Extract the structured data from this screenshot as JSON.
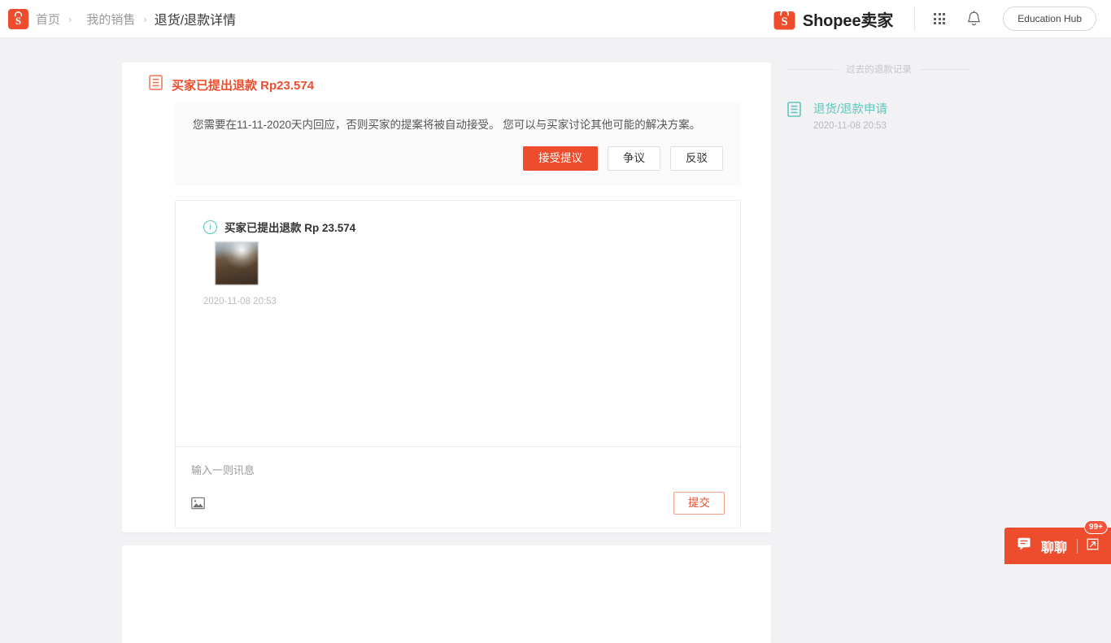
{
  "header": {
    "breadcrumb": [
      {
        "label": "首页",
        "current": false
      },
      {
        "label": "我的销售",
        "current": false
      },
      {
        "label": "退货/退款详情",
        "current": true
      }
    ],
    "separator": "›",
    "brand_name": "Shopee卖家",
    "apps_icon": "grid-apps-icon",
    "bell_icon": "bell-icon",
    "education_hub_label": "Education Hub",
    "brand_color": "#ee4d2d"
  },
  "alert": {
    "doc_icon": "document-icon",
    "title": "买家已提出退款 Rp23.574",
    "message": "您需要在11-11-2020天内回应，否则买家的提案将被自动接受。 您可以与买家讨论其他可能的解决方案。",
    "buttons": [
      {
        "label": "接受提议",
        "style": "primary",
        "name": "accept-proposal-button"
      },
      {
        "label": "争议",
        "style": "ghost",
        "name": "dispute-button"
      },
      {
        "label": "反驳",
        "style": "ghost",
        "name": "rebut-button"
      }
    ]
  },
  "chat": {
    "messages": [
      {
        "icon": "info-circle-icon",
        "title": "买家已提出退款 Rp 23.574",
        "attachment": "refund-photo-thumbnail",
        "time": "2020-11-08 20:53"
      }
    ],
    "input_placeholder": "输入一则讯息",
    "input_value": "",
    "image_upload_icon": "image-upload-icon",
    "submit_label": "提交"
  },
  "rail": {
    "section_label": "过去的退款记录",
    "items": [
      {
        "icon": "document-icon",
        "title": "退货/退款申请",
        "time": "2020-11-08 20:53",
        "color": "#5bc8bb"
      }
    ]
  },
  "chat_widget": {
    "icon": "chat-bubble-icon",
    "label": "聊聊",
    "expand_icon": "expand-arrow-icon",
    "badge": "99+",
    "color": "#ee4d2d"
  }
}
